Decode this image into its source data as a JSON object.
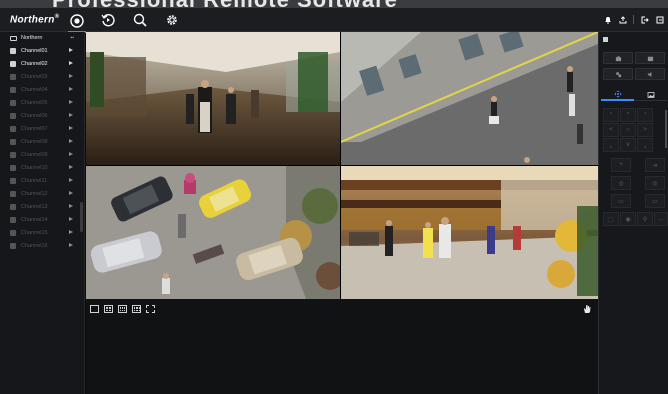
{
  "header": {
    "banner_text": "Professional Remote Software",
    "logo_text": "Northern",
    "logo_mark": "®",
    "nav": [
      {
        "name": "live-view-icon",
        "active": true
      },
      {
        "name": "playback-icon",
        "active": false
      },
      {
        "name": "search-icon",
        "active": false
      },
      {
        "name": "settings-icon",
        "active": false
      }
    ]
  },
  "sidebar": {
    "root_label": "Northern",
    "channels": [
      {
        "label": "Channel01",
        "active": true
      },
      {
        "label": "Channel02",
        "active": true
      },
      {
        "label": "Channel03",
        "active": false
      },
      {
        "label": "Channel04",
        "active": false
      },
      {
        "label": "Channel05",
        "active": false
      },
      {
        "label": "Channel06",
        "active": false
      },
      {
        "label": "Channel07",
        "active": false
      },
      {
        "label": "Channel08",
        "active": false
      },
      {
        "label": "Channel09",
        "active": false
      },
      {
        "label": "Channel10",
        "active": false
      },
      {
        "label": "Channel11",
        "active": false
      },
      {
        "label": "Channel12",
        "active": false
      },
      {
        "label": "Channel13",
        "active": false
      },
      {
        "label": "Channel14",
        "active": false
      },
      {
        "label": "Channel15",
        "active": false
      },
      {
        "label": "Channel16",
        "active": false
      }
    ]
  },
  "colors": {
    "accent": "#3d8bfd",
    "background": "#0b0b0c",
    "panel": "#16181b"
  }
}
